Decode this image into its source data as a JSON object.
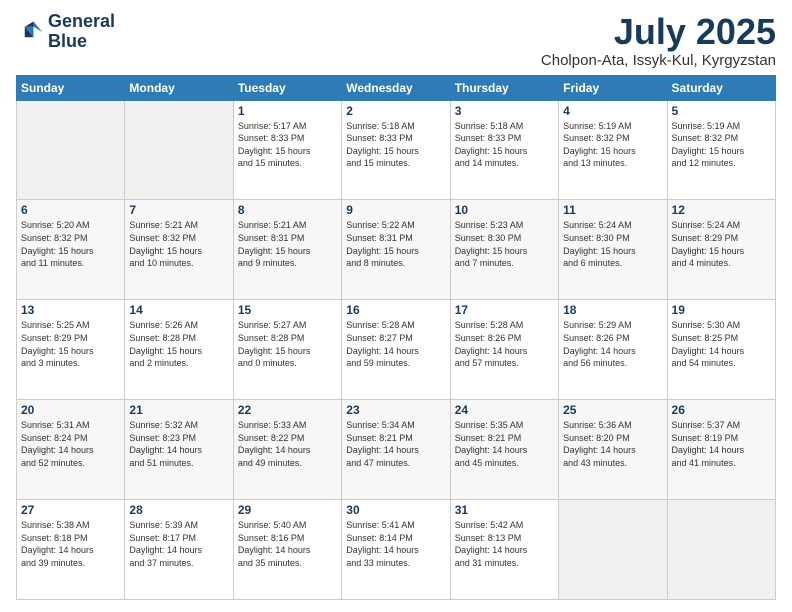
{
  "logo": {
    "line1": "General",
    "line2": "Blue"
  },
  "header": {
    "month": "July 2025",
    "location": "Cholpon-Ata, Issyk-Kul, Kyrgyzstan"
  },
  "weekdays": [
    "Sunday",
    "Monday",
    "Tuesday",
    "Wednesday",
    "Thursday",
    "Friday",
    "Saturday"
  ],
  "weeks": [
    [
      {
        "day": "",
        "info": ""
      },
      {
        "day": "",
        "info": ""
      },
      {
        "day": "1",
        "info": "Sunrise: 5:17 AM\nSunset: 8:33 PM\nDaylight: 15 hours\nand 15 minutes."
      },
      {
        "day": "2",
        "info": "Sunrise: 5:18 AM\nSunset: 8:33 PM\nDaylight: 15 hours\nand 15 minutes."
      },
      {
        "day": "3",
        "info": "Sunrise: 5:18 AM\nSunset: 8:33 PM\nDaylight: 15 hours\nand 14 minutes."
      },
      {
        "day": "4",
        "info": "Sunrise: 5:19 AM\nSunset: 8:32 PM\nDaylight: 15 hours\nand 13 minutes."
      },
      {
        "day": "5",
        "info": "Sunrise: 5:19 AM\nSunset: 8:32 PM\nDaylight: 15 hours\nand 12 minutes."
      }
    ],
    [
      {
        "day": "6",
        "info": "Sunrise: 5:20 AM\nSunset: 8:32 PM\nDaylight: 15 hours\nand 11 minutes."
      },
      {
        "day": "7",
        "info": "Sunrise: 5:21 AM\nSunset: 8:32 PM\nDaylight: 15 hours\nand 10 minutes."
      },
      {
        "day": "8",
        "info": "Sunrise: 5:21 AM\nSunset: 8:31 PM\nDaylight: 15 hours\nand 9 minutes."
      },
      {
        "day": "9",
        "info": "Sunrise: 5:22 AM\nSunset: 8:31 PM\nDaylight: 15 hours\nand 8 minutes."
      },
      {
        "day": "10",
        "info": "Sunrise: 5:23 AM\nSunset: 8:30 PM\nDaylight: 15 hours\nand 7 minutes."
      },
      {
        "day": "11",
        "info": "Sunrise: 5:24 AM\nSunset: 8:30 PM\nDaylight: 15 hours\nand 6 minutes."
      },
      {
        "day": "12",
        "info": "Sunrise: 5:24 AM\nSunset: 8:29 PM\nDaylight: 15 hours\nand 4 minutes."
      }
    ],
    [
      {
        "day": "13",
        "info": "Sunrise: 5:25 AM\nSunset: 8:29 PM\nDaylight: 15 hours\nand 3 minutes."
      },
      {
        "day": "14",
        "info": "Sunrise: 5:26 AM\nSunset: 8:28 PM\nDaylight: 15 hours\nand 2 minutes."
      },
      {
        "day": "15",
        "info": "Sunrise: 5:27 AM\nSunset: 8:28 PM\nDaylight: 15 hours\nand 0 minutes."
      },
      {
        "day": "16",
        "info": "Sunrise: 5:28 AM\nSunset: 8:27 PM\nDaylight: 14 hours\nand 59 minutes."
      },
      {
        "day": "17",
        "info": "Sunrise: 5:28 AM\nSunset: 8:26 PM\nDaylight: 14 hours\nand 57 minutes."
      },
      {
        "day": "18",
        "info": "Sunrise: 5:29 AM\nSunset: 8:26 PM\nDaylight: 14 hours\nand 56 minutes."
      },
      {
        "day": "19",
        "info": "Sunrise: 5:30 AM\nSunset: 8:25 PM\nDaylight: 14 hours\nand 54 minutes."
      }
    ],
    [
      {
        "day": "20",
        "info": "Sunrise: 5:31 AM\nSunset: 8:24 PM\nDaylight: 14 hours\nand 52 minutes."
      },
      {
        "day": "21",
        "info": "Sunrise: 5:32 AM\nSunset: 8:23 PM\nDaylight: 14 hours\nand 51 minutes."
      },
      {
        "day": "22",
        "info": "Sunrise: 5:33 AM\nSunset: 8:22 PM\nDaylight: 14 hours\nand 49 minutes."
      },
      {
        "day": "23",
        "info": "Sunrise: 5:34 AM\nSunset: 8:21 PM\nDaylight: 14 hours\nand 47 minutes."
      },
      {
        "day": "24",
        "info": "Sunrise: 5:35 AM\nSunset: 8:21 PM\nDaylight: 14 hours\nand 45 minutes."
      },
      {
        "day": "25",
        "info": "Sunrise: 5:36 AM\nSunset: 8:20 PM\nDaylight: 14 hours\nand 43 minutes."
      },
      {
        "day": "26",
        "info": "Sunrise: 5:37 AM\nSunset: 8:19 PM\nDaylight: 14 hours\nand 41 minutes."
      }
    ],
    [
      {
        "day": "27",
        "info": "Sunrise: 5:38 AM\nSunset: 8:18 PM\nDaylight: 14 hours\nand 39 minutes."
      },
      {
        "day": "28",
        "info": "Sunrise: 5:39 AM\nSunset: 8:17 PM\nDaylight: 14 hours\nand 37 minutes."
      },
      {
        "day": "29",
        "info": "Sunrise: 5:40 AM\nSunset: 8:16 PM\nDaylight: 14 hours\nand 35 minutes."
      },
      {
        "day": "30",
        "info": "Sunrise: 5:41 AM\nSunset: 8:14 PM\nDaylight: 14 hours\nand 33 minutes."
      },
      {
        "day": "31",
        "info": "Sunrise: 5:42 AM\nSunset: 8:13 PM\nDaylight: 14 hours\nand 31 minutes."
      },
      {
        "day": "",
        "info": ""
      },
      {
        "day": "",
        "info": ""
      }
    ]
  ]
}
